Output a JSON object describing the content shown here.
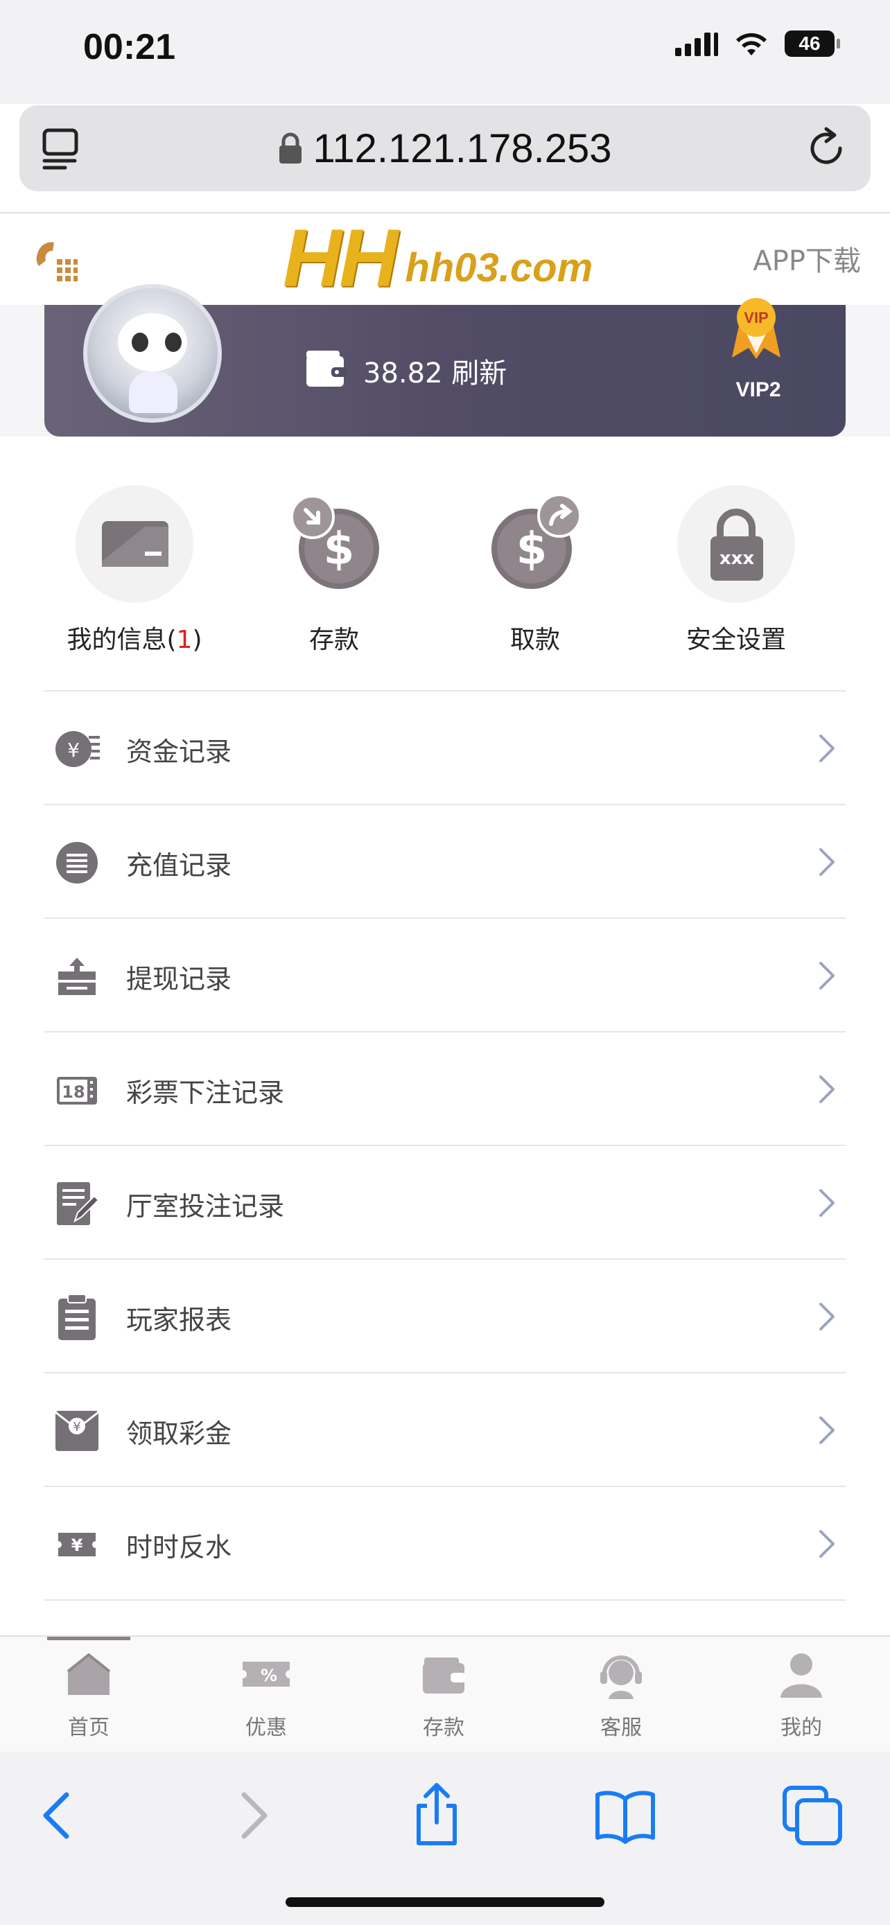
{
  "status_bar": {
    "time": "00:21",
    "battery": "46"
  },
  "address_bar": {
    "url": "112.121.178.253"
  },
  "site_header": {
    "logo_main": "HH",
    "logo_domain": "hh03.com",
    "app_download": "APP下载"
  },
  "user_card": {
    "balance": "38.82",
    "refresh_label": "刷新",
    "vip_level": "VIP2"
  },
  "quick_actions": [
    {
      "label": "我的信息(",
      "count": "1",
      "label_end": ")"
    },
    {
      "label": "存款"
    },
    {
      "label": "取款"
    },
    {
      "label": "安全设置"
    }
  ],
  "menu": [
    {
      "label": "资金记录",
      "icon": "yen-ledger-icon"
    },
    {
      "label": "充值记录",
      "icon": "list-circle-icon"
    },
    {
      "label": "提现记录",
      "icon": "withdraw-tray-icon"
    },
    {
      "label": "彩票下注记录",
      "icon": "lottery-ticket-icon"
    },
    {
      "label": "厅室投注记录",
      "icon": "edit-document-icon"
    },
    {
      "label": "玩家报表",
      "icon": "clipboard-icon"
    },
    {
      "label": "领取彩金",
      "icon": "red-envelope-icon"
    },
    {
      "label": "时时反水",
      "icon": "yen-ticket-icon"
    }
  ],
  "tab_bar": [
    {
      "label": "首页",
      "icon": "home-icon"
    },
    {
      "label": "优惠",
      "icon": "coupon-icon"
    },
    {
      "label": "存款",
      "icon": "wallet-icon"
    },
    {
      "label": "客服",
      "icon": "support-agent-icon"
    },
    {
      "label": "我的",
      "icon": "user-icon"
    }
  ],
  "colors": {
    "accent_gold": "#e8b21c",
    "card_purple": "#524c66",
    "toolbar_blue": "#1a7cf5",
    "badge_red": "#e0201a"
  }
}
